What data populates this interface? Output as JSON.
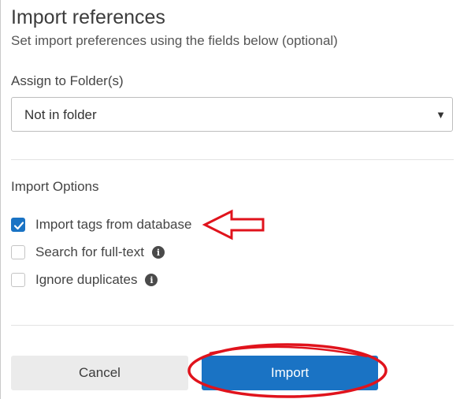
{
  "dialog": {
    "title": "Import references",
    "subtitle": "Set import preferences using the fields below (optional)"
  },
  "folder": {
    "label": "Assign to Folder(s)",
    "selected": "Not in folder",
    "caret_icon": "caret-down-icon"
  },
  "options": {
    "label": "Import Options",
    "items": [
      {
        "label": "Import tags from database",
        "checked": true
      },
      {
        "label": "Search for full-text",
        "checked": false,
        "info_icon": "info-icon"
      },
      {
        "label": "Ignore duplicates",
        "checked": false,
        "info_icon": "info-icon"
      }
    ]
  },
  "buttons": {
    "cancel": "Cancel",
    "import": "Import"
  },
  "colors": {
    "primary": "#1a73c4",
    "annotation": "#e0131c",
    "cancel_bg": "#ebebeb"
  }
}
